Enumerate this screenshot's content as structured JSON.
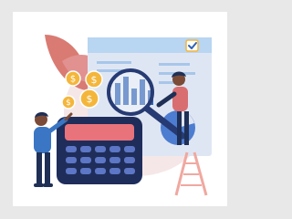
{
  "illustration": {
    "coins": [
      "$",
      "$",
      "$",
      "$"
    ],
    "colors": {
      "frame": "#e8e8e8",
      "card": "#ffffff",
      "document": "#dfe6f3",
      "document_header": "#b8d5f1",
      "accent_blue": "#2e63b6",
      "accent_red": "#d66a66",
      "coin_gold": "#f4b63a",
      "calculator": "#1f2d5b",
      "calculator_keys": "#5d76c5",
      "calculator_screen": "#e9737b",
      "plant": "#d97b72",
      "man_shirt": "#3a76c4",
      "man_pants": "#1f2f55",
      "ladder": "#f0a8a0",
      "magnifier_ring": "#263a73"
    }
  }
}
